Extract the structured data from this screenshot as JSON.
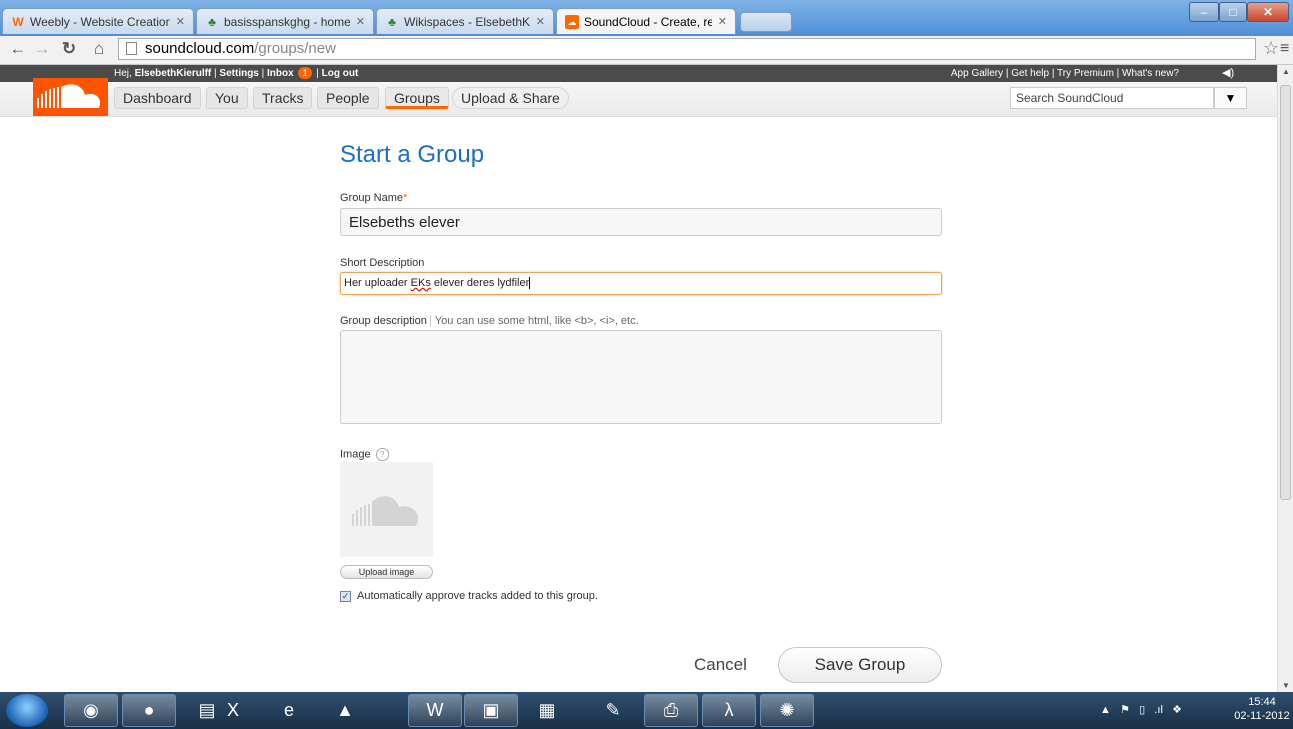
{
  "browser": {
    "tabs": [
      {
        "title": "Weebly - Website Creation",
        "icon": "weebly-icon",
        "active": false
      },
      {
        "title": "basisspanskghg - home",
        "icon": "wikispaces-icon",
        "active": false
      },
      {
        "title": "Wikispaces - ElsebethKieru",
        "icon": "wikispaces-icon",
        "active": false
      },
      {
        "title": "SoundCloud - Create, reco",
        "icon": "soundcloud-icon",
        "active": true
      }
    ],
    "url_host": "soundcloud.com",
    "url_path": "/groups/new"
  },
  "sc_topbar": {
    "greeting_prefix": "Hej,",
    "username": "ElsebethKierulff",
    "settings": "Settings",
    "inbox": "Inbox",
    "inbox_count": "1",
    "logout": "Log out",
    "right_links": "App Gallery | Get help | Try Premium | What's new?"
  },
  "nav": {
    "dashboard": "Dashboard",
    "you": "You",
    "tracks": "Tracks",
    "people": "People",
    "groups": "Groups",
    "upload": "Upload & Share",
    "search_placeholder": "Search SoundCloud"
  },
  "form": {
    "title": "Start a Group",
    "group_name_label": "Group Name",
    "required_mark": "*",
    "group_name_value": "Elsebeths elever",
    "short_desc_label": "Short Description",
    "short_desc_pre": "Her uploader ",
    "short_desc_spell": "EKs",
    "short_desc_post": " elever deres lydfiler",
    "group_desc_label": "Group description",
    "group_desc_hint": "You can use some html, like <b>, <i>, etc.",
    "image_label": "Image",
    "help_mark": "?",
    "upload_image": "Upload image",
    "auto_approve": "Automatically approve tracks added to this group.",
    "auto_approve_checked": true,
    "cancel": "Cancel",
    "save": "Save Group"
  },
  "taskbar": {
    "apps": [
      "chrome-icon",
      "firefox-icon",
      "explorer-icon",
      "excel-icon",
      "ie-icon",
      "vlc-icon",
      "word-icon",
      "photo-icon",
      "publisher-icon",
      "notes-icon",
      "scanner-icon",
      "acrobat-icon",
      "people-icon"
    ],
    "time": "15:44",
    "date": "02-11-2012"
  }
}
